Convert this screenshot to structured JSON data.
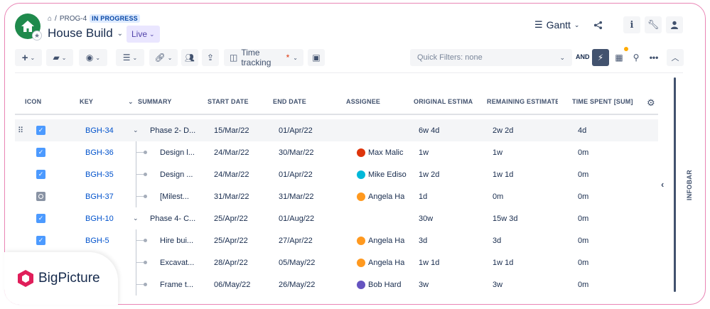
{
  "header": {
    "breadcrumb_id": "PROG-4",
    "breadcrumb_sep": "/",
    "status": "IN PROGRESS",
    "title": "House Build",
    "live_label": "Live",
    "view_label": "Gantt"
  },
  "toolbar": {
    "time_tracking_label": "Time tracking",
    "required_marker": "*",
    "quick_filters_placeholder": "Quick Filters: none",
    "and_label": "AND"
  },
  "columns": {
    "icon": "ICON",
    "key": "KEY",
    "summary": "SUMMARY",
    "start_date": "START DATE",
    "end_date": "END DATE",
    "assignee": "ASSIGNEE",
    "original_estimate": "ORIGINAL ESTIMATE",
    "remaining_estimate": "REMAINING ESTIMATE [",
    "time_spent": "TIME SPENT [SUM]"
  },
  "rows": [
    {
      "key": "BGH-34",
      "summary": "Phase 2- D...",
      "start": "15/Mar/22",
      "end": "01/Apr/22",
      "assignee": "",
      "avatar_color": "",
      "orig": "6w 4d",
      "remaining": "2w 2d",
      "spent": "4d",
      "type": "parent",
      "icon": "checkbox-icon"
    },
    {
      "key": "BGH-36",
      "summary": "Design l...",
      "start": "24/Mar/22",
      "end": "30/Mar/22",
      "assignee": "Max Malic",
      "avatar_color": "#de350b",
      "orig": "1w",
      "remaining": "1w",
      "spent": "0m",
      "type": "child",
      "icon": "checkbox-icon"
    },
    {
      "key": "BGH-35",
      "summary": "Design ...",
      "start": "24/Mar/22",
      "end": "01/Apr/22",
      "assignee": "Mike Ediso",
      "avatar_color": "#00b8d9",
      "orig": "1w 2d",
      "remaining": "1w 1d",
      "spent": "0m",
      "type": "child",
      "icon": "checkbox-icon"
    },
    {
      "key": "BGH-37",
      "summary": "[Milest...",
      "start": "31/Mar/22",
      "end": "31/Mar/22",
      "assignee": "Angela Ha",
      "avatar_color": "#ff991f",
      "orig": "1d",
      "remaining": "0m",
      "spent": "0m",
      "type": "child",
      "icon": "milestone-icon"
    },
    {
      "key": "BGH-10",
      "summary": "Phase 4- C...",
      "start": "25/Apr/22",
      "end": "01/Aug/22",
      "assignee": "",
      "avatar_color": "",
      "orig": "30w",
      "remaining": "15w 3d",
      "spent": "0m",
      "type": "parent-plain",
      "icon": "checkbox-icon"
    },
    {
      "key": "BGH-5",
      "summary": "Hire bui...",
      "start": "25/Apr/22",
      "end": "27/Apr/22",
      "assignee": "Angela Ha",
      "avatar_color": "#ff991f",
      "orig": "3d",
      "remaining": "3d",
      "spent": "0m",
      "type": "child",
      "icon": "checkbox-icon"
    },
    {
      "key": "",
      "summary": "Excavat...",
      "start": "28/Apr/22",
      "end": "05/May/22",
      "assignee": "Angela Ha",
      "avatar_color": "#ff991f",
      "orig": "1w 1d",
      "remaining": "1w 1d",
      "spent": "0m",
      "type": "child",
      "icon": ""
    },
    {
      "key": "",
      "summary": "Frame t...",
      "start": "06/May/22",
      "end": "26/May/22",
      "assignee": "Bob Hard",
      "avatar_color": "#6554c0",
      "orig": "3w",
      "remaining": "3w",
      "spent": "0m",
      "type": "child",
      "icon": ""
    }
  ],
  "infobar": {
    "label": "INFOBAR"
  },
  "logo": {
    "text": "BigPicture"
  },
  "colors": {
    "accent": "#0052cc",
    "status_bg": "#deebff",
    "live_bg": "#eae6ff",
    "brand": "#e01e5a"
  }
}
